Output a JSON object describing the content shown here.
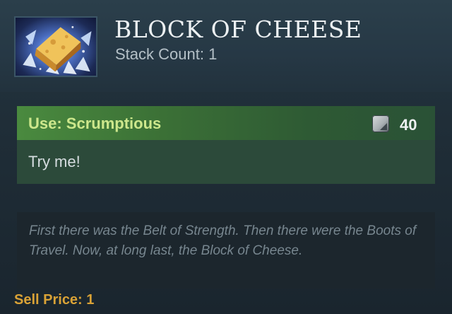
{
  "item": {
    "title": "BLOCK OF CHEESE",
    "stack_count": "Stack Count: 1",
    "icon": "block-of-cheese-icon"
  },
  "ability": {
    "name": "Use: Scrumptious",
    "charge_icon": "charge-stone-icon",
    "charges": "40",
    "description": "Try me!"
  },
  "lore": {
    "text": "First there was the Belt of Strength. Then there were the Boots of Travel. Now, at long last, the Block of Cheese."
  },
  "sell": {
    "label": "Sell Price: 1"
  },
  "colors": {
    "ability_header": "#3b7036",
    "ability_name": "#cde78c",
    "sell_price": "#d9a236",
    "lore_text": "#77868f"
  }
}
